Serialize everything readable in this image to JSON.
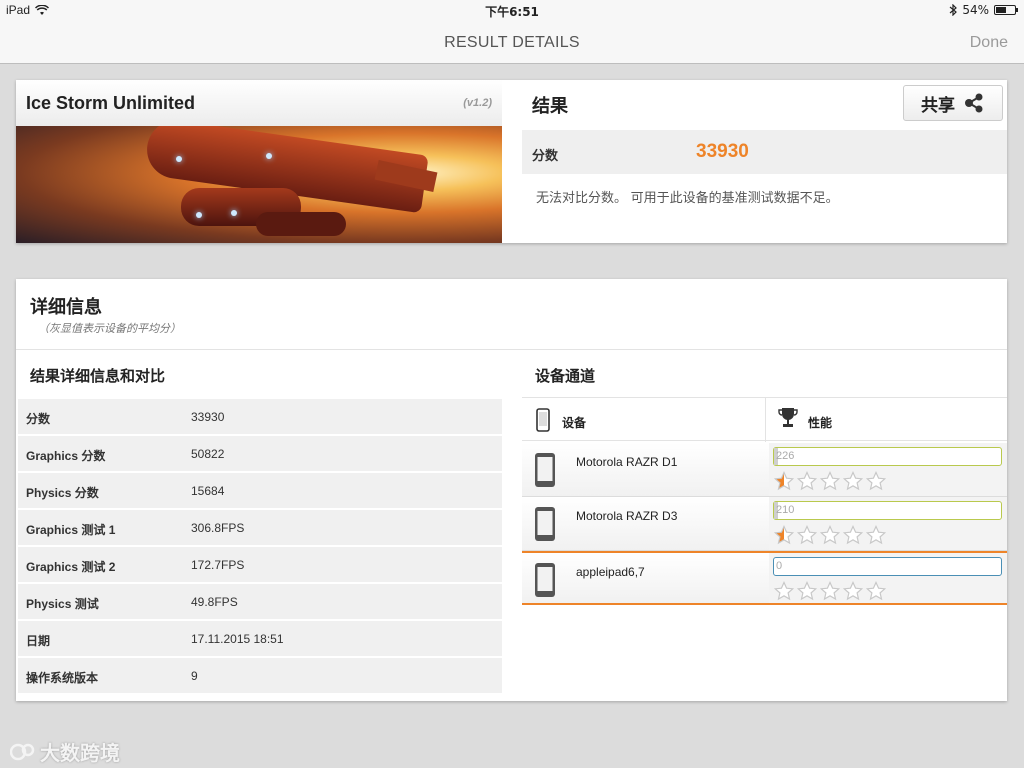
{
  "status_bar": {
    "device": "iPad",
    "time": "下午6:51",
    "battery": "54%",
    "battery_level": 0.54
  },
  "nav": {
    "title": "RESULT DETAILS",
    "done": "Done"
  },
  "benchmark": {
    "name": "Ice Storm Unlimited",
    "version": "(v1.2)"
  },
  "result": {
    "title": "结果",
    "share_label": "共享",
    "score_label": "分数",
    "score_value": "33930",
    "compare_note": "无法对比分数。 可用于此设备的基准测试数据不足。"
  },
  "details": {
    "title": "详细信息",
    "subtitle": "（灰显值表示设备的平均分）",
    "breakdown_title": "结果详细信息和对比",
    "rows": [
      {
        "label": "分数",
        "value": "33930"
      },
      {
        "label": "Graphics 分数",
        "value": "50822"
      },
      {
        "label": "Physics 分数",
        "value": "15684"
      },
      {
        "label": "Graphics 测试 1",
        "value": "306.8FPS"
      },
      {
        "label": "Graphics 测试 2",
        "value": "172.7FPS"
      },
      {
        "label": "Physics 测试",
        "value": "49.8FPS"
      },
      {
        "label": "日期",
        "value": "17.11.2015 18:51"
      },
      {
        "label": "操作系统版本",
        "value": "9"
      }
    ]
  },
  "device_channel": {
    "title": "设备通道",
    "col_device": "设备",
    "col_performance": "性能",
    "devices": [
      {
        "name": "Motorola RAZR D1",
        "score": "226",
        "rating": 0.5,
        "current": false
      },
      {
        "name": "Motorola RAZR D3",
        "score": "210",
        "rating": 0.5,
        "current": false
      },
      {
        "name": "appleipad6,7",
        "score": "0",
        "rating": 0,
        "current": true
      }
    ]
  },
  "colors": {
    "accent": "#ee8429",
    "bar_border": "#b9c94d",
    "bar_border_current": "#4a8fb5"
  },
  "watermark": "大数跨境"
}
